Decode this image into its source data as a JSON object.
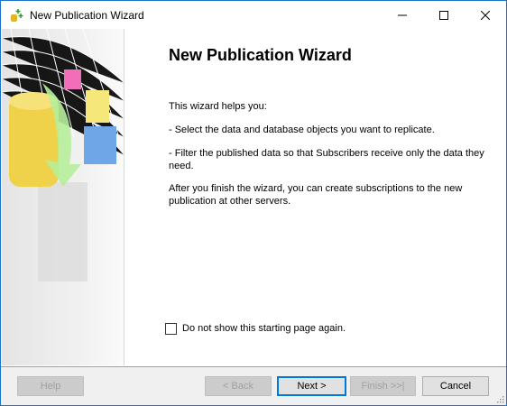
{
  "window": {
    "title": "New Publication Wizard",
    "icon": "publication-wizard-icon"
  },
  "controls": {
    "minimize": "minimize-icon",
    "maximize": "maximize-icon",
    "close": "close-icon"
  },
  "main": {
    "heading": "New Publication Wizard",
    "intro": "This wizard helps you:",
    "bullet1": "- Select the data and database objects you want to replicate.",
    "bullet2": "- Filter the published data so that Subscribers receive only the data they need.",
    "after": "After you finish the wizard, you can create subscriptions to the new publication at other servers."
  },
  "checkbox": {
    "label": "Do not show this starting page again.",
    "checked": false
  },
  "buttons": {
    "help": "Help",
    "back": "< Back",
    "next": "Next >",
    "finish": "Finish >>|",
    "cancel": "Cancel"
  },
  "colors": {
    "accent": "#0078d7"
  }
}
